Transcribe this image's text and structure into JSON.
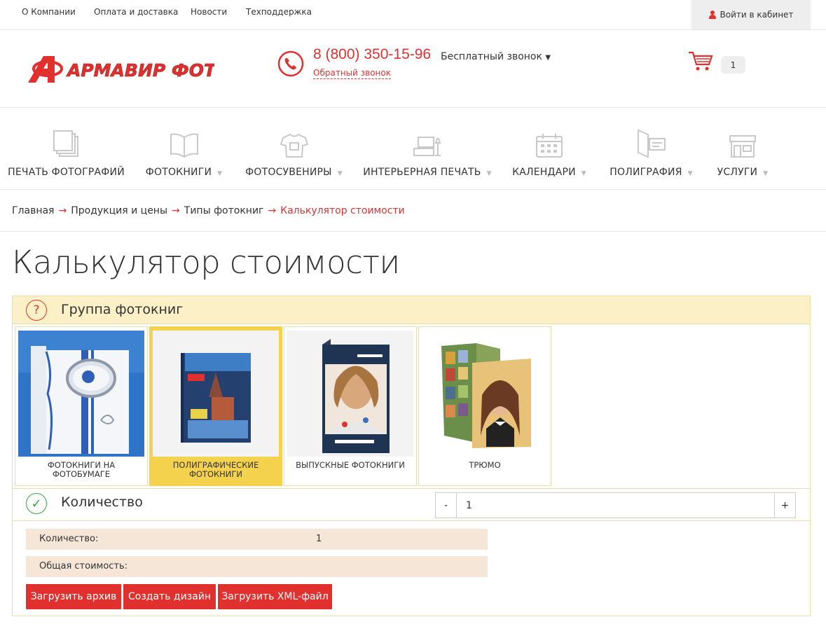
{
  "topnav": {
    "links": [
      "О Компании",
      "Оплата и доставка",
      "Новости",
      "Техподдержка"
    ],
    "login": "Войти в кабинет"
  },
  "header": {
    "logo_text": "АРМАВИР ФОТО",
    "phone": "8 (800) 350-15-96",
    "free_call": "Бесплатный звонок",
    "callback": "Обратный звонок",
    "cart_count": "1"
  },
  "nav": {
    "items": [
      {
        "label": "ПЕЧАТЬ ФОТОГРАФИЙ",
        "icon": "photo-stack-icon",
        "has_dropdown": false
      },
      {
        "label": "ФОТОКНИГИ",
        "icon": "open-book-icon",
        "has_dropdown": true
      },
      {
        "label": "ФОТОСУВЕНИРЫ",
        "icon": "tshirt-icon",
        "has_dropdown": true
      },
      {
        "label": "ИНТЕРЬЕРНАЯ ПЕЧАТЬ",
        "icon": "interior-icon",
        "has_dropdown": true
      },
      {
        "label": "КАЛЕНДАРИ",
        "icon": "calendar-icon",
        "has_dropdown": true
      },
      {
        "label": "ПОЛИГРАФИЯ",
        "icon": "printing-icon",
        "has_dropdown": true
      },
      {
        "label": "УСЛУГИ",
        "icon": "store-icon",
        "has_dropdown": true
      }
    ]
  },
  "breadcrumb": {
    "items": [
      "Главная",
      "Продукция и цены",
      "Типы фотокниг"
    ],
    "current": "Калькулятор стоимости"
  },
  "page": {
    "title": "Калькулятор стоимости"
  },
  "calculator": {
    "group": {
      "title": "Группа фотокниг",
      "options": [
        {
          "label": "ФОТОКНИГИ НА ФОТОБУМАГЕ",
          "selected": false
        },
        {
          "label": "ПОЛИГРАФИЧЕСКИЕ ФОТОКНИГИ",
          "selected": true
        },
        {
          "label": "ВЫПУСКНЫЕ ФОТОКНИГИ",
          "selected": false
        },
        {
          "label": "ТРЮМО",
          "selected": false
        }
      ]
    },
    "quantity": {
      "title": "Количество",
      "value": "1",
      "minus": "-",
      "plus": "+"
    },
    "summary": {
      "qty_label": "Количество:",
      "qty_value": "1",
      "total_label": "Общая стоимость:"
    },
    "buttons": {
      "upload_archive": "Загрузить архив",
      "create_design": "Создать дизайн",
      "upload_xml": "Загрузить XML-файл"
    }
  },
  "colors": {
    "accent": "#e0312f",
    "highlight": "#f5d24d",
    "panel": "#fcf1c6",
    "success": "#3aa443"
  }
}
